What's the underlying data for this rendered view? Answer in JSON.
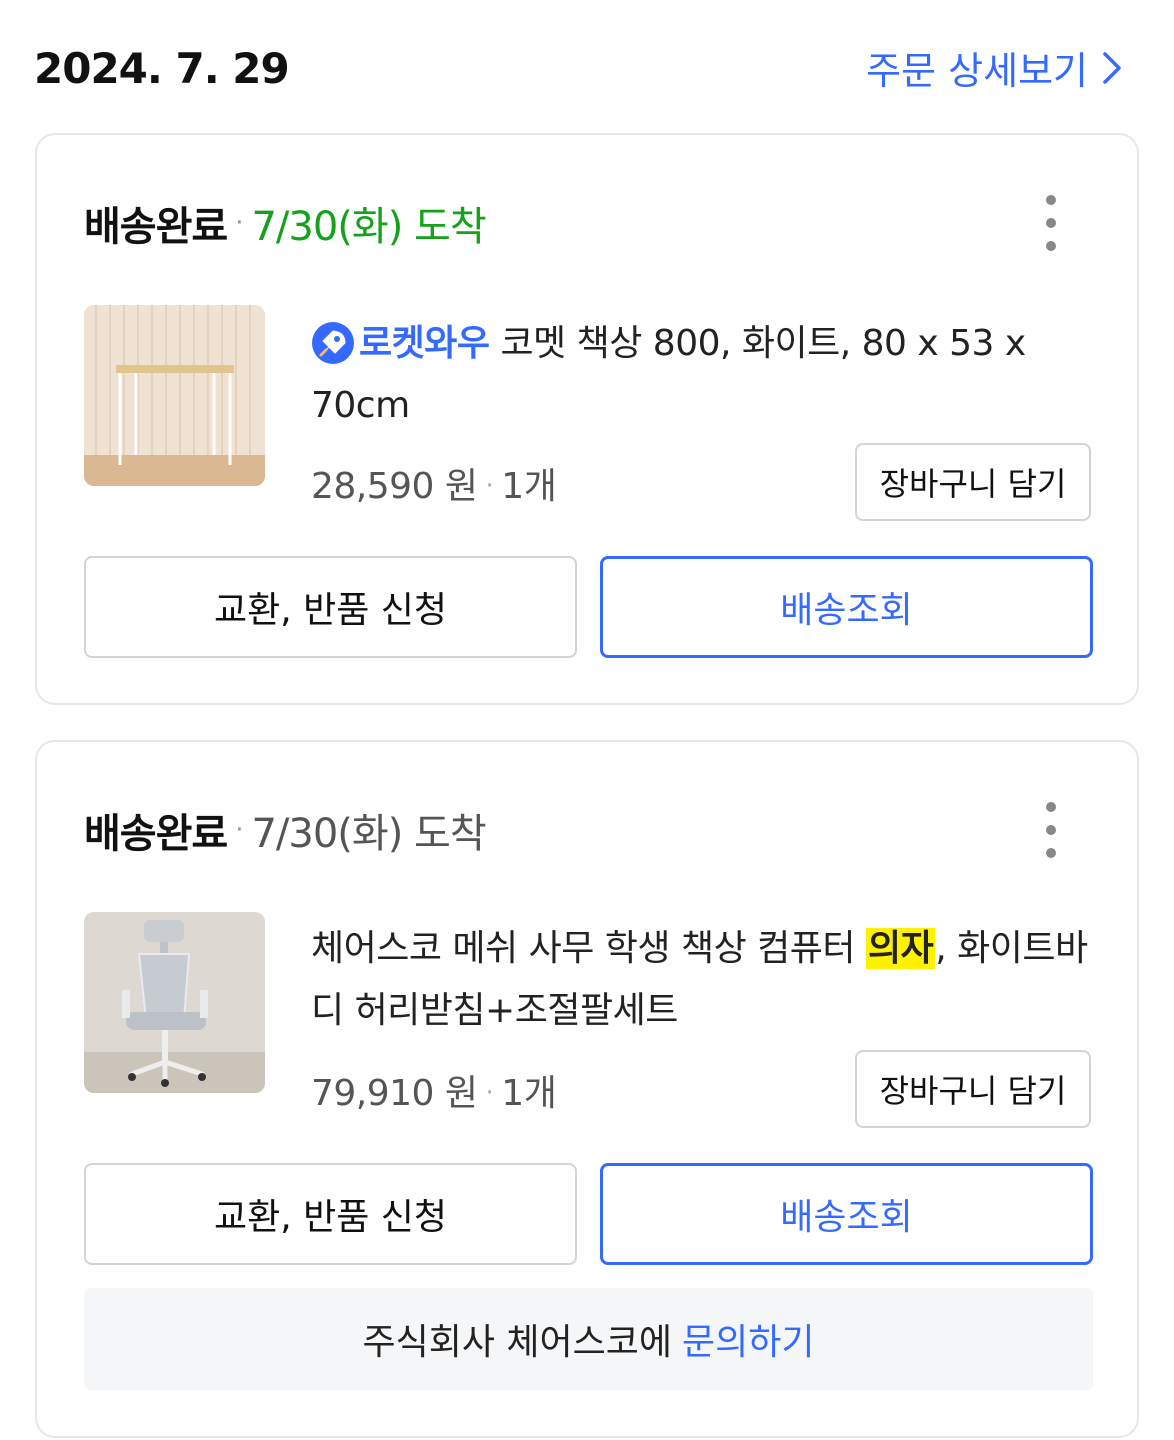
{
  "order": {
    "date": "2024. 7. 29",
    "detail_link_label": "주문 상세보기"
  },
  "items": [
    {
      "status": "배송완료",
      "arrival": "7/30(화) 도착",
      "arrival_color": "#14a11b",
      "badge_label": "로켓와우",
      "title": "코멧 책상 800, 화이트, 80 x 53 x 70cm",
      "price": "28,590 원",
      "quantity": "1개",
      "cart_button": "장바구니 담기",
      "return_button": "교환, 반품 신청",
      "track_button": "배송조회"
    },
    {
      "status": "배송완료",
      "arrival": "7/30(화) 도착",
      "arrival_color": "#555555",
      "title_before": "체어스코 메쉬 사무 학생 책상 컴퓨터 ",
      "title_highlight": "의자",
      "title_after": ", 화이트바디 허리받침+조절팔세트",
      "price": "79,910 원",
      "quantity": "1개",
      "cart_button": "장바구니 담기",
      "return_button": "교환, 반품 신청",
      "track_button": "배송조회",
      "seller_text": "주식회사 체어스코에",
      "inquiry_link": "문의하기"
    }
  ],
  "colors": {
    "accent_blue": "#346aff",
    "highlight_yellow": "#fff200",
    "delivered_green": "#14a11b"
  },
  "icons": [
    "chevron-right-icon",
    "more-vertical-icon",
    "rocket-icon"
  ]
}
